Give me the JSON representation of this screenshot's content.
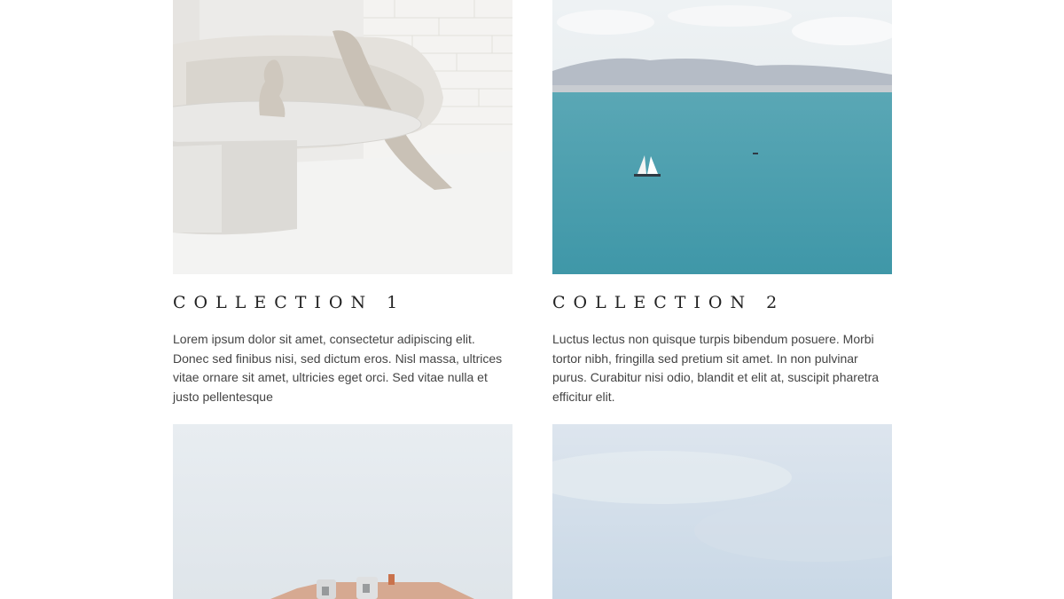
{
  "collections": [
    {
      "title": "COLLECTION 1",
      "description": "Lorem ipsum dolor sit amet, consectetur adipiscing elit. Donec sed finibus nisi, sed dictum eros. Nisl massa, ultrices vitae ornare sit amet, ultricies eget orci. Sed vitae nulla et justo pellentesque",
      "image": "living-room-photo"
    },
    {
      "title": "COLLECTION 2",
      "description": "Luctus lectus non quisque turpis bibendum posuere. Morbi tortor nibh, fringilla sed pretium sit amet. In non pulvinar purus. Curabitur nisi odio, blandit et elit at, suscipit pharetra efficitur elit.",
      "image": "sea-sailboat-photo"
    },
    {
      "image": "coastal-house-photo"
    },
    {
      "image": "sky-photo"
    }
  ],
  "colors": {
    "title": "#222222",
    "text": "#444444",
    "background": "#ffffff"
  }
}
